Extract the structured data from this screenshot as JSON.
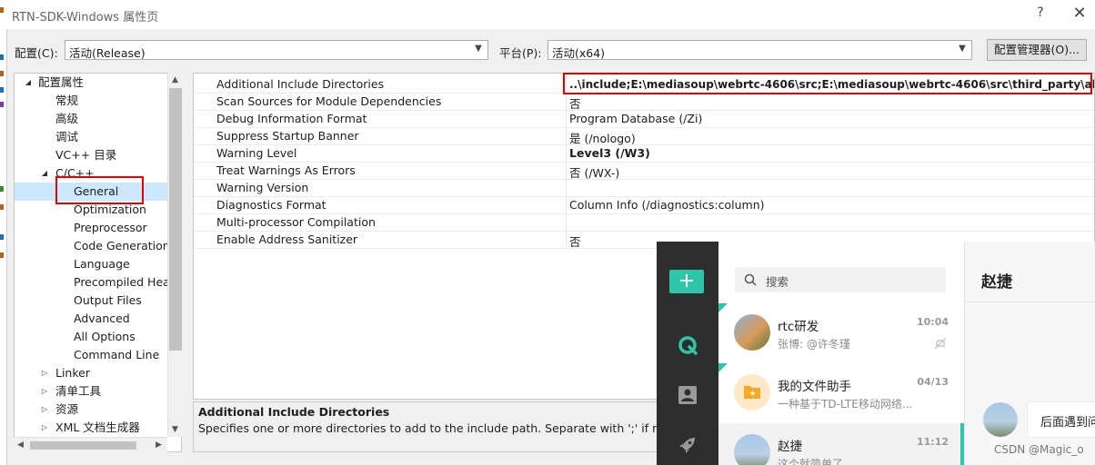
{
  "window": {
    "title": "RTN-SDK-Windows 属性页",
    "help": "?",
    "close": "✕"
  },
  "config": {
    "config_label": "配置(C):",
    "config_value": "活动(Release)",
    "platform_label": "平台(P):",
    "platform_value": "活动(x64)",
    "manager_button": "配置管理器(O)..."
  },
  "tree": {
    "root": "配置属性",
    "items": [
      "常规",
      "高级",
      "调试",
      "VC++ 目录"
    ],
    "cpp": "C/C++",
    "cpp_items": [
      "General",
      "Optimization",
      "Preprocessor",
      "Code Generation",
      "Language",
      "Precompiled Headers",
      "Output Files",
      "Advanced",
      "All Options",
      "Command Line"
    ],
    "after": [
      "Linker",
      "清单工具",
      "资源",
      "XML 文档生成器"
    ]
  },
  "grid": {
    "rows": [
      {
        "name": "Additional Include Directories",
        "value": "..\\include;E:\\mediasoup\\webrtc-4606\\src;E:\\mediasoup\\webrtc-4606\\src\\third_party\\abseil-cpp"
      },
      {
        "name": "Scan Sources for Module Dependencies",
        "value": "否"
      },
      {
        "name": "Debug Information Format",
        "value": "Program Database (/Zi)"
      },
      {
        "name": "Suppress Startup Banner",
        "value": "是 (/nologo)"
      },
      {
        "name": "Warning Level",
        "value": "Level3 (/W3)"
      },
      {
        "name": "Treat Warnings As Errors",
        "value": "否 (/WX-)"
      },
      {
        "name": "Warning Version",
        "value": ""
      },
      {
        "name": "Diagnostics Format",
        "value": "Column Info (/diagnostics:column)"
      },
      {
        "name": "Multi-processor Compilation",
        "value": ""
      },
      {
        "name": "Enable Address Sanitizer",
        "value": "否"
      }
    ]
  },
  "description": {
    "title": "Additional Include Directories",
    "text": "Specifies one or more directories to add to the include path. Separate with ';' if more than one."
  },
  "chat": {
    "add": "+",
    "search_placeholder": "搜索",
    "conversations": [
      {
        "name": "rtc研发",
        "snippet": "张博: @许冬瑾",
        "time": "10:04"
      },
      {
        "name": "我的文件助手",
        "snippet": "一种基于TD-LTE移动网络...",
        "time": "04/13"
      },
      {
        "name": "赵捷",
        "snippet": "这个就简单了",
        "time": "11:12"
      }
    ],
    "active_contact": "赵捷",
    "bubble": "后面遇到问"
  },
  "watermark": "CSDN @Magic_o",
  "colors": {
    "accent": "#2ec5a8",
    "annotation": "#e00000",
    "selection": "#cce8ff"
  }
}
